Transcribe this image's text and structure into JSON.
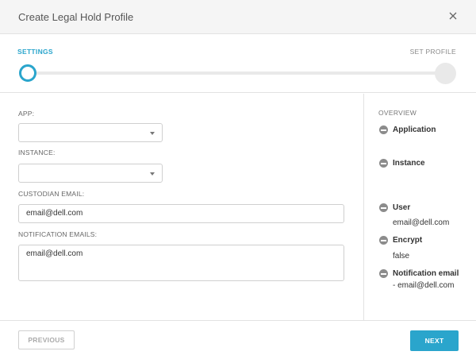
{
  "dialog": {
    "title": "Create Legal Hold Profile",
    "close_icon": "close-icon"
  },
  "stepper": {
    "steps": [
      {
        "label": "SETTINGS",
        "state": "active"
      },
      {
        "label": "SET PROFILE",
        "state": "inactive"
      }
    ],
    "active_color": "#2aa5cc"
  },
  "form": {
    "app": {
      "label": "APP:",
      "value": ""
    },
    "instance": {
      "label": "INSTANCE:",
      "value": ""
    },
    "custodian_email": {
      "label": "CUSTODIAN EMAIL:",
      "value": "email@dell.com"
    },
    "notification_emails": {
      "label": "NOTIFICATION EMAILS:",
      "value": "email@dell.com"
    }
  },
  "overview": {
    "title": "OVERVIEW",
    "items": [
      {
        "label": "Application",
        "value": ""
      },
      {
        "label": "Instance",
        "value": ""
      },
      {
        "label": "User",
        "value": "email@dell.com"
      },
      {
        "label": "Encrypt",
        "value": "false"
      },
      {
        "label": "Notification email",
        "value": "- email@dell.com"
      }
    ],
    "icon": "minus-circle-icon"
  },
  "footer": {
    "previous_label": "PREVIOUS",
    "next_label": "NEXT",
    "next_color": "#2aa5cc"
  }
}
